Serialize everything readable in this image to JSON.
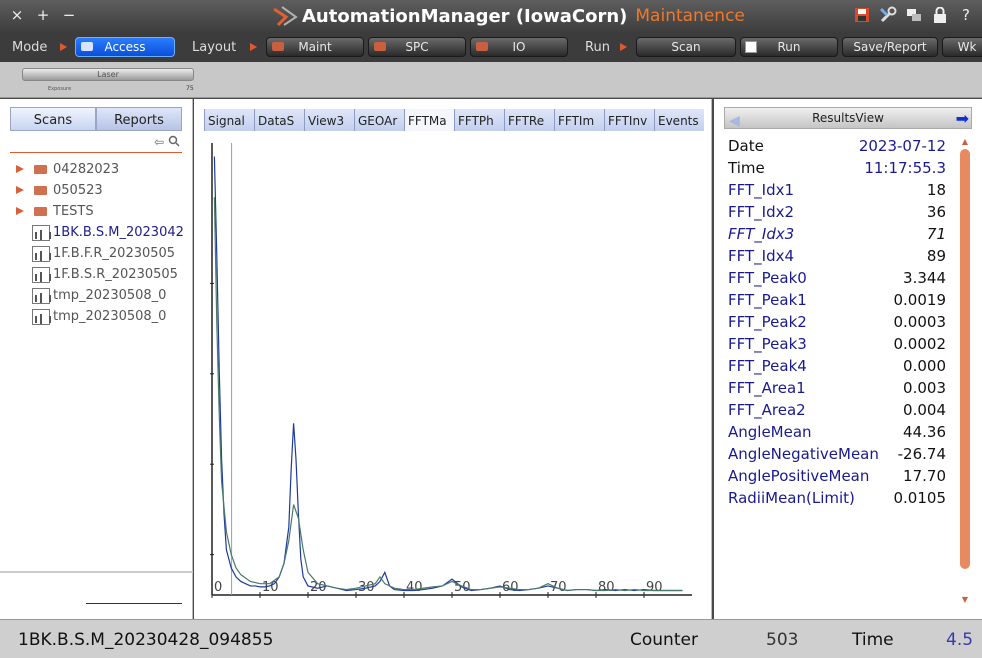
{
  "window": {
    "controls": [
      "×",
      "+",
      "−"
    ],
    "title": "AutomationManager (IowaCorn)",
    "mode_label": "Maintanence",
    "icons": [
      "save-icon",
      "tools-icon",
      "windows-icon",
      "lock-icon",
      "help-icon"
    ],
    "help_glyph": "?"
  },
  "toolbar": {
    "mode_label": "Mode",
    "access_button": "Access",
    "layout_label": "Layout",
    "layout_buttons": [
      "Maint",
      "SPC",
      "IO"
    ],
    "run_label": "Run",
    "scan_button": "Scan",
    "run_button": "Run",
    "save_report_button": "Save/Report",
    "wk_button": "Wk"
  },
  "strip": {
    "laser_label": "Laser",
    "exposure_label": "Exposure",
    "exposure_value": "75"
  },
  "left_panel": {
    "tabs": [
      "Scans",
      "Reports"
    ],
    "tree": [
      {
        "type": "folder",
        "label": "04282023"
      },
      {
        "type": "folder",
        "label": "050523"
      },
      {
        "type": "folder",
        "label": "TESTS"
      },
      {
        "type": "file",
        "label": "1BK.B.S.M_20230428_094855",
        "selected": true
      },
      {
        "type": "file",
        "label": "1F.B.F.R_20230505"
      },
      {
        "type": "file",
        "label": "1F.B.S.R_20230505"
      },
      {
        "type": "file",
        "label": "tmp_20230508_0"
      },
      {
        "type": "file",
        "label": "tmp_20230508_0"
      }
    ]
  },
  "center_panel": {
    "tabs": [
      "Signal",
      "DataS",
      "View3",
      "GEOAr",
      "FFTMa",
      "FFTPh",
      "FFTRe",
      "FFTIm",
      "FFTInv",
      "Events"
    ],
    "selected_tab": "FFTMa"
  },
  "chart_data": {
    "type": "line",
    "x_ticks": [
      0,
      10,
      20,
      30,
      40,
      50,
      60,
      70,
      80,
      90
    ],
    "xlim": [
      0,
      100
    ],
    "ylim": [
      0,
      1
    ],
    "grid": false,
    "series": [
      {
        "color": "#1e3aa0",
        "x": [
          0.5,
          1,
          1.5,
          2,
          2.5,
          3,
          4,
          5,
          6,
          7,
          8,
          9,
          10,
          11,
          12,
          13,
          14,
          15,
          16,
          16.5,
          17,
          17.5,
          18,
          18.5,
          19,
          20,
          22,
          24,
          26,
          28,
          30,
          32,
          34,
          35,
          36,
          37,
          38,
          40,
          42,
          44,
          46,
          48,
          50,
          52,
          54,
          56,
          58,
          60,
          62,
          64,
          66,
          68,
          70,
          72,
          74,
          76,
          78,
          80,
          82,
          84,
          86,
          88,
          90,
          92,
          94,
          96,
          98
        ],
        "y": [
          0.97,
          0.75,
          0.5,
          0.3,
          0.18,
          0.1,
          0.06,
          0.04,
          0.03,
          0.025,
          0.02,
          0.02,
          0.018,
          0.018,
          0.02,
          0.025,
          0.04,
          0.07,
          0.15,
          0.28,
          0.38,
          0.3,
          0.18,
          0.08,
          0.04,
          0.02,
          0.015,
          0.02,
          0.015,
          0.01,
          0.012,
          0.015,
          0.02,
          0.03,
          0.05,
          0.02,
          0.012,
          0.01,
          0.01,
          0.012,
          0.015,
          0.02,
          0.035,
          0.018,
          0.01,
          0.012,
          0.015,
          0.02,
          0.012,
          0.01,
          0.012,
          0.015,
          0.02,
          0.015,
          0.01,
          0.012,
          0.012,
          0.01,
          0.012,
          0.01,
          0.012,
          0.01,
          0.012,
          0.01,
          0.01,
          0.01,
          0.01
        ]
      },
      {
        "color": "#4a7a68",
        "x": [
          0.5,
          1,
          1.5,
          2,
          3,
          4,
          5,
          6,
          8,
          10,
          12,
          14,
          15,
          16,
          17,
          18,
          19,
          20,
          22,
          24,
          26,
          28,
          30,
          32,
          34,
          35,
          36,
          38,
          40,
          42,
          44,
          46,
          48,
          50,
          52,
          54,
          56,
          58,
          60,
          62,
          64,
          66,
          68,
          70,
          72,
          74,
          76,
          78,
          80,
          82,
          84,
          86,
          88,
          90,
          92,
          94,
          96,
          98
        ],
        "y": [
          0.88,
          0.6,
          0.4,
          0.25,
          0.14,
          0.09,
          0.06,
          0.045,
          0.03,
          0.025,
          0.025,
          0.04,
          0.07,
          0.12,
          0.2,
          0.17,
          0.1,
          0.05,
          0.025,
          0.02,
          0.015,
          0.012,
          0.015,
          0.02,
          0.025,
          0.04,
          0.025,
          0.015,
          0.012,
          0.012,
          0.015,
          0.018,
          0.02,
          0.03,
          0.02,
          0.012,
          0.012,
          0.015,
          0.018,
          0.015,
          0.012,
          0.012,
          0.015,
          0.025,
          0.015,
          0.01,
          0.012,
          0.012,
          0.01,
          0.01,
          0.012,
          0.01,
          0.012,
          0.01,
          0.01,
          0.01,
          0.01,
          0.01
        ]
      }
    ],
    "cursor_x": 2
  },
  "results_view": {
    "title": "ResultsView",
    "rows": [
      {
        "key": "Date",
        "value": "2023-07-12",
        "style": "date"
      },
      {
        "key": "Time",
        "value": "11:17:55.3",
        "style": "date"
      },
      {
        "key": "FFT_Idx1",
        "value": "18"
      },
      {
        "key": "FFT_Idx2",
        "value": "36"
      },
      {
        "key": "FFT_Idx3",
        "value": "71",
        "style": "it"
      },
      {
        "key": "FFT_Idx4",
        "value": "89"
      },
      {
        "key": "FFT_Peak0",
        "value": "3.344"
      },
      {
        "key": "FFT_Peak1",
        "value": "0.0019"
      },
      {
        "key": "FFT_Peak2",
        "value": "0.0003"
      },
      {
        "key": "FFT_Peak3",
        "value": "0.0002"
      },
      {
        "key": "FFT_Peak4",
        "value": "0.000"
      },
      {
        "key": "FFT_Area1",
        "value": "0.003"
      },
      {
        "key": "FFT_Area2",
        "value": "0.004"
      },
      {
        "key": "AngleMean",
        "value": "44.36"
      },
      {
        "key": "AngleNegativeMean",
        "value": "-26.74"
      },
      {
        "key": "AnglePositiveMean",
        "value": "17.70"
      },
      {
        "key": "RadiiMean(Limit)",
        "value": "0.0105"
      }
    ]
  },
  "status_bar": {
    "scan_name": "1BK.B.S.M_20230428_094855",
    "counter_label": "Counter",
    "counter_value": "503",
    "time_label": "Time",
    "time_value": "4.5"
  },
  "colors": {
    "accent_orange": "#f07828",
    "access_blue": "#0a4fd8",
    "link_blue": "#1a1a90"
  }
}
